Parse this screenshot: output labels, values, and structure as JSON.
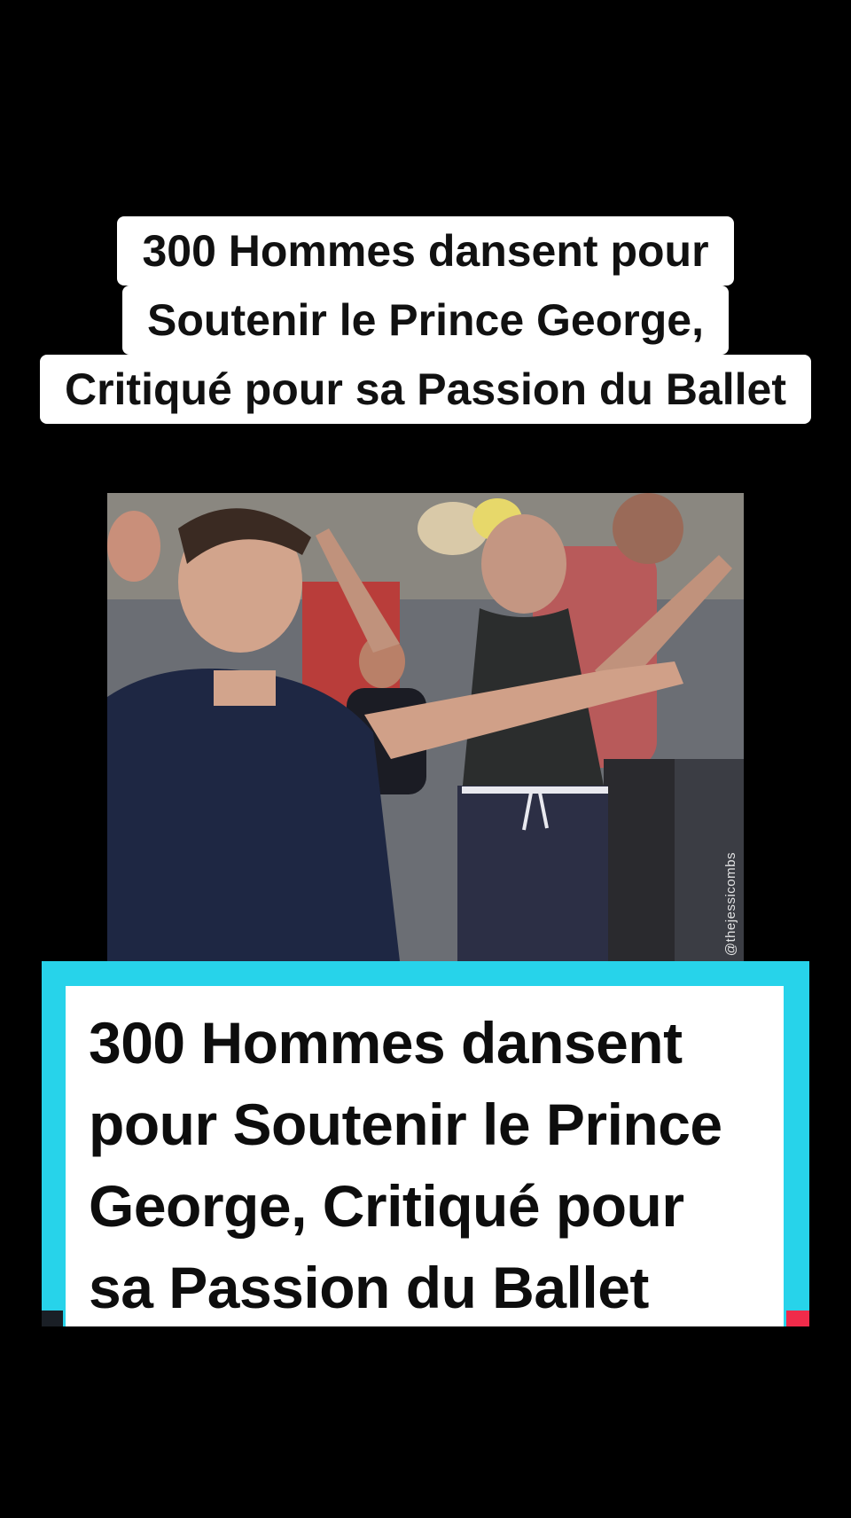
{
  "caption": {
    "lines": [
      "300 Hommes dansent pour",
      "Soutenir le Prince George,",
      "Critiqué pour sa Passion du Ballet"
    ]
  },
  "video": {
    "watermark": "@thejessicombs"
  },
  "card": {
    "lines": [
      "300 Hommes dansent",
      "pour Soutenir le Prince",
      "George, Critiqué pour",
      "sa Passion du Ballet"
    ],
    "accent_color": "#27d3ea",
    "left_strip_color": "#1a1f26",
    "right_strip_color": "#f02b4a"
  }
}
